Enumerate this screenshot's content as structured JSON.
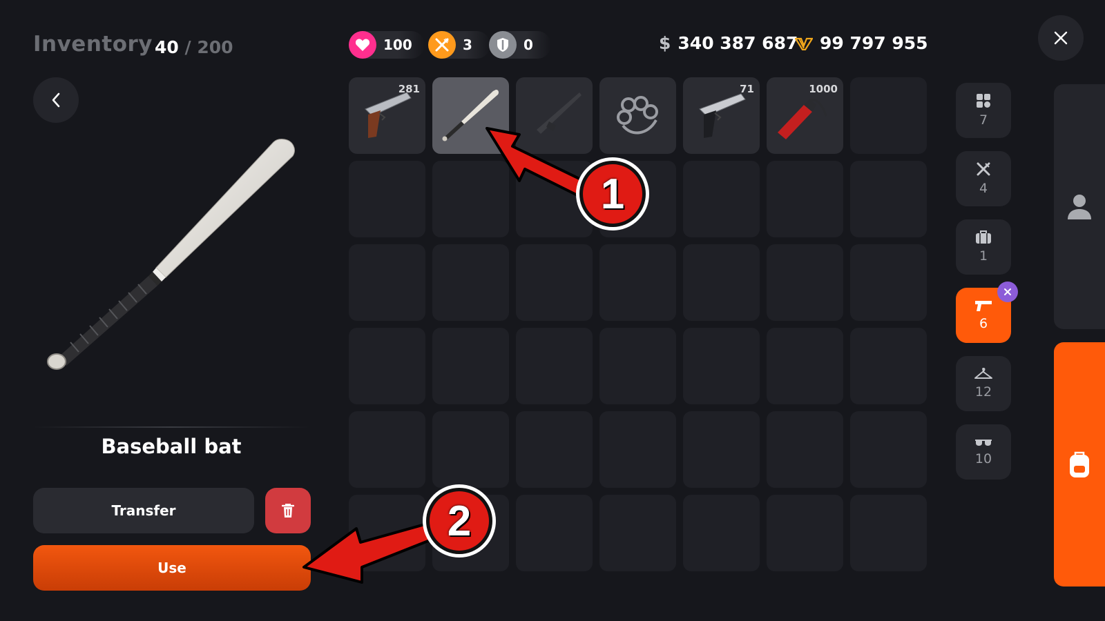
{
  "header": {
    "title": "Inventory",
    "count_current": "40",
    "count_separator": "/",
    "count_max": "200"
  },
  "stats": {
    "health": "100",
    "food": "3",
    "armor": "0",
    "health_color": "#ff2f8e",
    "food_color": "#ff9a1c",
    "armor_color": "#8a8d93"
  },
  "money": {
    "cash_symbol": "$",
    "cash": "340 387 687",
    "gold": "99 797 955"
  },
  "selected_item": {
    "name": "Baseball bat"
  },
  "actions": {
    "transfer": "Transfer",
    "use": "Use"
  },
  "slots": [
    {
      "item": "pistol-brown-grip-icon",
      "qty": "281",
      "selected": false
    },
    {
      "item": "baseball-bat-icon",
      "qty": "",
      "selected": true
    },
    {
      "item": "rifle-icon",
      "qty": "",
      "selected": false
    },
    {
      "item": "brass-knuckles-icon",
      "qty": "",
      "selected": false
    },
    {
      "item": "pistol-black-grip-icon",
      "qty": "71",
      "selected": false
    },
    {
      "item": "fire-extinguisher-icon",
      "qty": "1000",
      "selected": false
    }
  ],
  "categories": [
    {
      "icon": "all-items-icon",
      "count": "7"
    },
    {
      "icon": "food-icon",
      "count": "4"
    },
    {
      "icon": "suitcase-icon",
      "count": "1"
    },
    {
      "icon": "pistol-icon",
      "count": "6",
      "active": true
    },
    {
      "icon": "hanger-icon",
      "count": "12"
    },
    {
      "icon": "glasses-icon",
      "count": "10"
    }
  ],
  "annotations": {
    "marker_1": "1",
    "marker_2": "2",
    "color": "#e01b14"
  },
  "colors": {
    "accent": "#ff5a0a",
    "danger": "#d13b3f",
    "background": "#16171c"
  }
}
